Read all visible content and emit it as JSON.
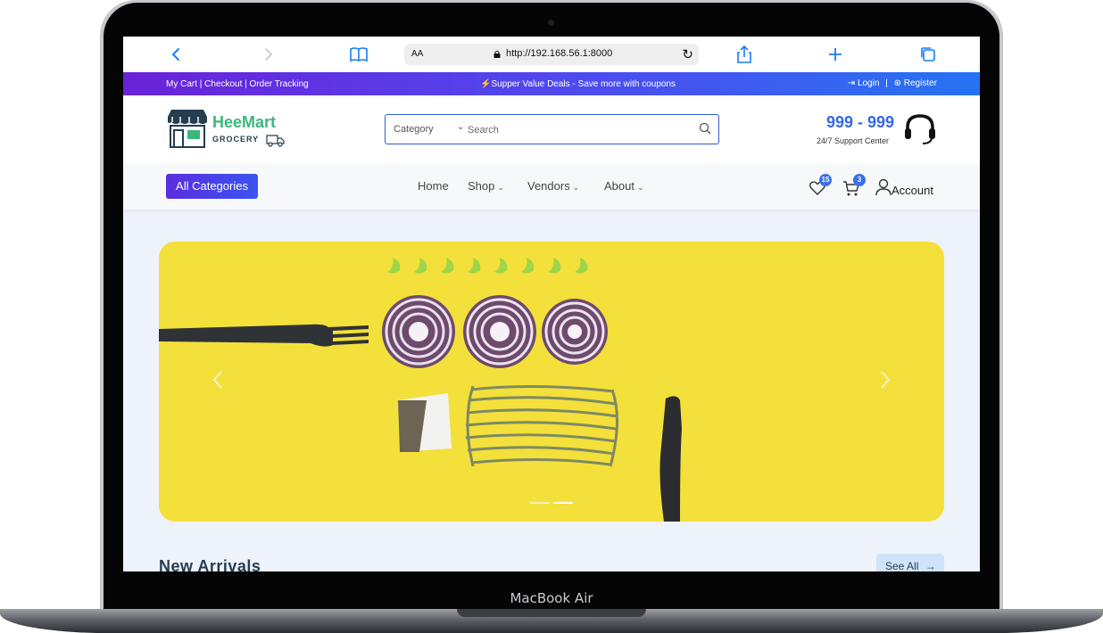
{
  "device": {
    "label": "MacBook Air"
  },
  "browser": {
    "aa_label": "AA",
    "url": "http://192.168.56.1:8000"
  },
  "promo": {
    "left_links": "My Cart | Checkout | Order Tracking",
    "message": "Supper Value Deals - Save more with coupons",
    "login": "Login",
    "separator": "|",
    "register": "Register"
  },
  "header": {
    "brand": "HeeMart",
    "brand_sub": "GROCERY",
    "search": {
      "category": "Category",
      "placeholder": "Search"
    },
    "phone": "999 - 999",
    "support": "24/7 Support Center"
  },
  "nav": {
    "all_categories": "All Categories",
    "items": [
      {
        "label": "Home"
      },
      {
        "label": "Shop"
      },
      {
        "label": "Vendors"
      },
      {
        "label": "About"
      }
    ],
    "wishlist_count": "15",
    "cart_count": "3",
    "account": "Account"
  },
  "hero": {
    "slide_count": 2,
    "active_slide": 2
  },
  "section": {
    "title": "New Arrivals",
    "see_all": "See All"
  },
  "colors": {
    "accent": "#3a6ff0",
    "brand_green": "#3bb77e",
    "hero_bg": "#f4e03a"
  }
}
